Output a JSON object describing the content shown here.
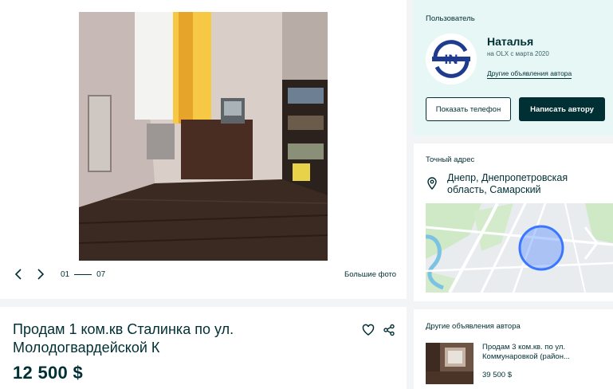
{
  "gallery": {
    "photo_alt": "room-photo",
    "counter_current": "01",
    "counter_total": "07",
    "big_photos_label": "Большие фото",
    "prev_icon": "chevron-left-icon",
    "next_icon": "chevron-right-icon"
  },
  "user": {
    "section_label": "Пользователь",
    "name": "Наталья",
    "since": "на OLX с марта 2020",
    "other_ads_link": "Другие объявления автора",
    "show_phone_label": "Показать телефон",
    "write_label": "Написать автору",
    "avatar_text": "IN"
  },
  "address": {
    "section_label": "Точный адрес",
    "text": "Днепр, Днепропетровская область, Самарский",
    "pin_icon": "location-pin-icon"
  },
  "ad": {
    "title": "Продам 1 ком.кв Сталинка по ул. Молодогвардейской К",
    "price": "12 500 $",
    "favorite_icon": "heart-icon",
    "share_icon": "share-icon"
  },
  "other_ads": {
    "section_label": "Другие объявления автора",
    "items": [
      {
        "title": "Продам 3 ком.кв. по ул. Коммунаровкой (район...",
        "price": "39 500 $"
      }
    ]
  },
  "colors": {
    "primary": "#002f34",
    "user_card_bg": "#e6f7f6",
    "page_bg": "#f2f4f5",
    "map_circle": "#3a77ff"
  }
}
